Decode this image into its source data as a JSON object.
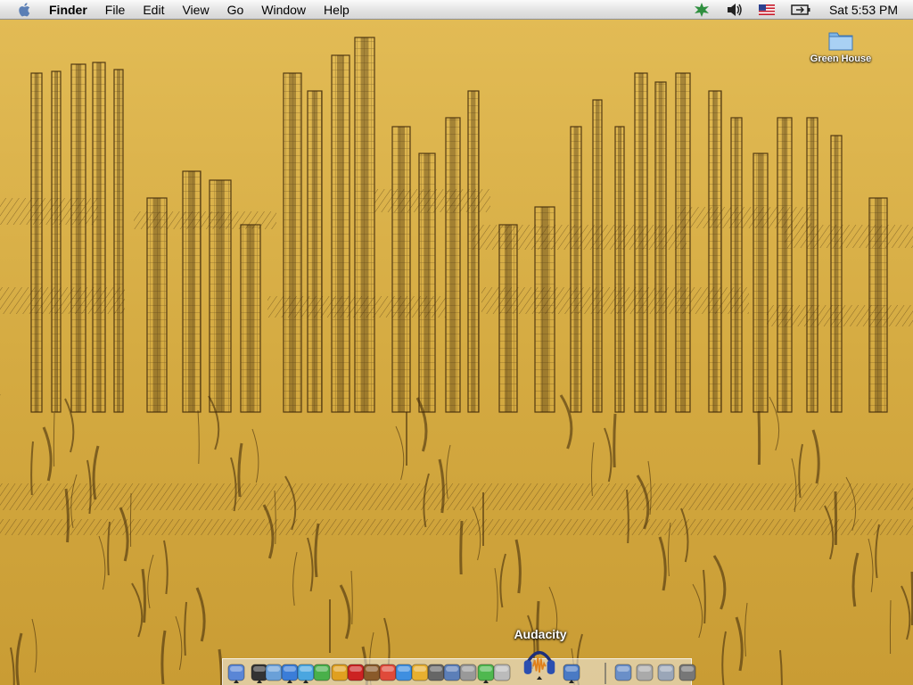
{
  "menubar": {
    "apple_icon": "apple-icon",
    "app_name": "Finder",
    "items": [
      "File",
      "Edit",
      "View",
      "Go",
      "Window",
      "Help"
    ],
    "status_icons": [
      "script-menu-icon",
      "volume-icon",
      "us-flag-input-icon",
      "battery-icon"
    ],
    "clock": "Sat 5:53 PM"
  },
  "desktop": {
    "icons": [
      {
        "label": "Green House",
        "icon": "folder-icon"
      }
    ]
  },
  "dock": {
    "hover_label": "Audacity",
    "items": [
      {
        "name": "finder",
        "icon": "finder-icon",
        "running": true
      },
      {
        "name": "dashboard",
        "icon": "dashboard-icon",
        "running": true
      },
      {
        "name": "system-preferences",
        "icon": "gear-globe-icon",
        "running": false
      },
      {
        "name": "safari",
        "icon": "safari-icon",
        "running": true
      },
      {
        "name": "mail",
        "icon": "mail-icon",
        "running": true
      },
      {
        "name": "itunes",
        "icon": "itunes-icon",
        "running": false
      },
      {
        "name": "shield",
        "icon": "shield-icon",
        "running": false
      },
      {
        "name": "stop-app",
        "icon": "stop-sign-icon",
        "running": false
      },
      {
        "name": "tool",
        "icon": "hammer-icon",
        "running": false
      },
      {
        "name": "ical",
        "icon": "calendar-icon",
        "running": false
      },
      {
        "name": "ichat",
        "icon": "chat-icon",
        "running": false
      },
      {
        "name": "pencil-app",
        "icon": "pencil-icon",
        "running": false
      },
      {
        "name": "script-editor",
        "icon": "script-icon",
        "running": false
      },
      {
        "name": "preview",
        "icon": "preview-icon",
        "running": false
      },
      {
        "name": "notes",
        "icon": "notes-icon",
        "running": false
      },
      {
        "name": "music",
        "icon": "music-note-icon",
        "running": true
      },
      {
        "name": "apple-app",
        "icon": "apple-logo-icon",
        "running": false
      },
      {
        "name": "audacity",
        "icon": "headphones-waveform-icon",
        "running": true
      },
      {
        "name": "photo-app",
        "icon": "photo-icon",
        "running": true
      },
      {
        "name": "mail-address",
        "icon": "address-book-icon",
        "running": false
      },
      {
        "name": "documents",
        "icon": "documents-icon",
        "running": false
      },
      {
        "name": "folder-stack",
        "icon": "folder-stack-icon",
        "running": false
      },
      {
        "name": "trash",
        "icon": "trash-icon",
        "running": false
      }
    ]
  },
  "colors": {
    "wallpaper_base": "#d9b148",
    "wallpaper_ink": "#3a2408",
    "menubar": "#e8e8e8"
  }
}
